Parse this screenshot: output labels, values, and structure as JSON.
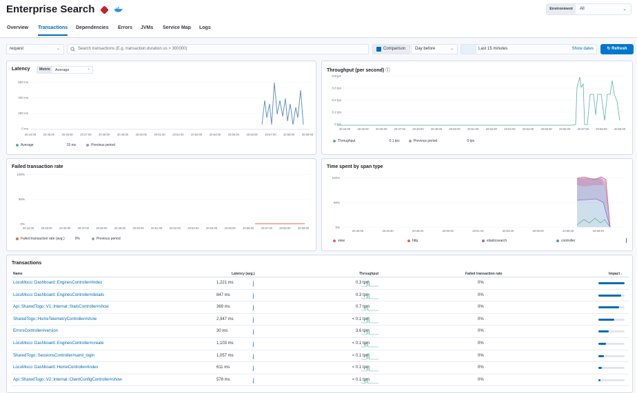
{
  "app": {
    "title": "Enterprise Search"
  },
  "environment": {
    "label": "Environment",
    "value": "All"
  },
  "tabs": [
    {
      "label": "Overview",
      "active": false
    },
    {
      "label": "Transactions",
      "active": true
    },
    {
      "label": "Dependencies",
      "active": false
    },
    {
      "label": "Errors",
      "active": false
    },
    {
      "label": "JVMs",
      "active": false
    },
    {
      "label": "Service Map",
      "active": false
    },
    {
      "label": "Logs",
      "active": false
    }
  ],
  "filters": {
    "type": "request",
    "search_placeholder": "Search transactions (E.g. transaction.duration.us > 300000)",
    "comparison_label": "Comparison",
    "comparison_option": "Day before",
    "time_range": "Last 15 minutes",
    "show_dates": "Show dates",
    "refresh": "Refresh"
  },
  "latency": {
    "title": "Latency",
    "metric_label": "Metric",
    "metric_value": "Average",
    "y_ticks": [
      "600 ms",
      "400 ms",
      "200 ms",
      "0 ms"
    ],
    "x_ticks": [
      "20:44:00",
      "20:45:00",
      "20:46:00",
      "20:47:00",
      "20:48:00",
      "20:49:00",
      "20:50:00",
      "20:51:00",
      "20:52:00",
      "20:53:00",
      "20:54:00",
      "20:55:00",
      "20:56:00",
      "20:57:00",
      "20:58:00",
      "20:59:00"
    ],
    "legend": [
      {
        "name": "Average",
        "value": "15 ms",
        "color": "#54b399"
      },
      {
        "name": "Previous period",
        "value": "",
        "color": "#98a2b3"
      }
    ],
    "line_color": "#6092c0"
  },
  "throughput": {
    "title": "Throughput (per second)",
    "y_ticks": [
      "0.8 tps",
      "0.6 tps",
      "0.4 tps",
      "0.2 tps",
      "0 tps"
    ],
    "x_ticks": [
      "20:44:00",
      "20:45:00",
      "20:46:00",
      "20:47:00",
      "20:48:00",
      "20:49:00",
      "20:50:00",
      "20:51:00",
      "20:52:00",
      "20:53:00",
      "20:54:00",
      "20:55:00",
      "20:56:00",
      "20:57:00",
      "20:58:00",
      "20:59:00"
    ],
    "legend": [
      {
        "name": "Throughput",
        "value": "0.1 tps",
        "color": "#54b399"
      },
      {
        "name": "Previous period",
        "value": "0 tps",
        "color": "#98a2b3"
      }
    ]
  },
  "failed_rate": {
    "title": "Failed transaction rate",
    "y_ticks": [
      "100%",
      "50%",
      "0%"
    ],
    "x_ticks": [
      "20:44:00",
      "20:45:00",
      "20:46:00",
      "20:47:00",
      "20:48:00",
      "20:49:00",
      "20:50:00",
      "20:51:00",
      "20:52:00",
      "20:53:00",
      "20:54:00",
      "20:55:00",
      "20:56:00",
      "20:57:00",
      "20:58:00",
      "20:59:00"
    ],
    "legend": [
      {
        "name": "Failed transaction rate (avg.)",
        "value": "0%",
        "color": "#e7664c"
      },
      {
        "name": "Previous period",
        "value": "",
        "color": "#98a2b3"
      }
    ]
  },
  "span_type": {
    "title": "Time spent by span type",
    "y_ticks": [
      "100%",
      "50%",
      "0%"
    ],
    "x_ticks": [
      "20:45:00",
      "20:46:40",
      "20:48:20",
      "20:50:00",
      "20:51:40",
      "20:53:20",
      "20:55:00",
      "20:56:40",
      "20:58:20"
    ],
    "legend": [
      {
        "name": "view",
        "color": "#d36086"
      },
      {
        "name": "http",
        "color": "#e7664c"
      },
      {
        "name": "elasticsearch",
        "color": "#9170b8"
      },
      {
        "name": "controller",
        "color": "#6092c0"
      }
    ]
  },
  "transactions": {
    "title": "Transactions",
    "headers": {
      "name": "Name",
      "latency": "Latency (avg.)",
      "throughput": "Throughput",
      "failed": "Failed transaction rate",
      "impact": "Impact"
    },
    "sort_icon": "arrow-down-icon",
    "rows": [
      {
        "name": "LocoMoco::Dashboard::EnginesController#index",
        "latency": "1,221 ms",
        "throughput": "0.3 tpm",
        "failed": "0%",
        "impact": 0.25
      },
      {
        "name": "LocoMoco::Dashboard::EnginesController#details",
        "latency": "847 ms",
        "throughput": "0.3 tpm",
        "failed": "0%",
        "impact": 0.22
      },
      {
        "name": "Api::SharedTogo::V1::Internal::StatsController#show",
        "latency": "369 ms",
        "throughput": "0.7 tpm",
        "failed": "0%",
        "impact": 0.2
      },
      {
        "name": "SharedTogo::HomeTelemetryController#show",
        "latency": "2,947 ms",
        "throughput": "< 0.1 tpm",
        "failed": "0%",
        "impact": 0.15
      },
      {
        "name": "ErrorsController#version",
        "latency": "30 ms",
        "throughput": "3.6 tpm",
        "failed": "0%",
        "impact": 0.1
      },
      {
        "name": "LocoMoco::Dashboard::EnginesController#create",
        "latency": "1,103 ms",
        "throughput": "< 0.1 tpm",
        "failed": "0%",
        "impact": 0.07
      },
      {
        "name": "SharedTogo::SessionsController#saml_login",
        "latency": "1,057 ms",
        "throughput": "< 0.1 tpm",
        "failed": "0%",
        "impact": 0.05
      },
      {
        "name": "LocoMoco::Dashboard::HomeController#index",
        "latency": "611 ms",
        "throughput": "< 0.1 tpm",
        "failed": "0%",
        "impact": 0.03
      },
      {
        "name": "Api::SharedTogo::V2::Internal::ClientConfigController#show",
        "latency": "578 ms",
        "throughput": "< 0.1 tpm",
        "failed": "0%",
        "impact": 0.02
      }
    ]
  }
}
